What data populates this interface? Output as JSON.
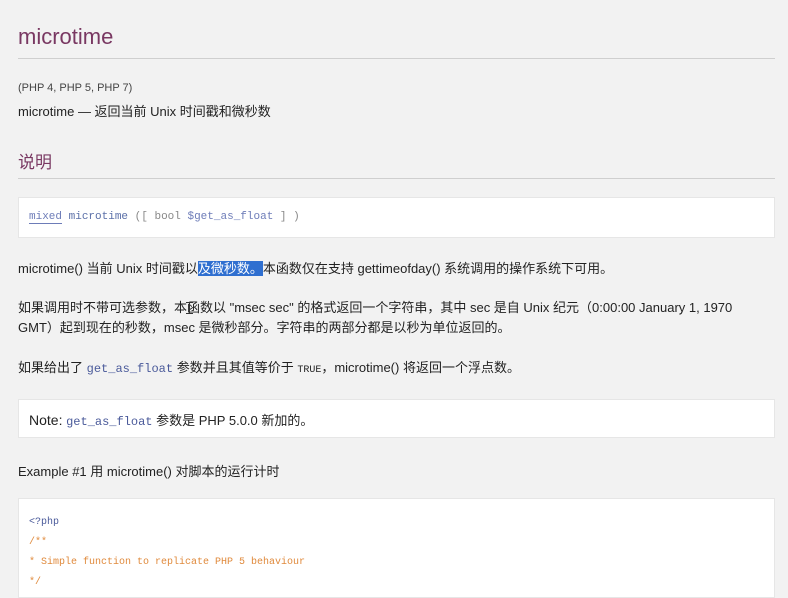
{
  "title": "microtime",
  "versions": "(PHP 4, PHP 5, PHP 7)",
  "refname": "microtime — 返回当前 Unix 时间戳和微秒数",
  "section_heading": "说明",
  "synopsis": {
    "type": "mixed",
    "function": "microtime",
    "open": "([",
    "param_type": "bool",
    "param": "$get_as_float",
    "close": "] )"
  },
  "para1": {
    "before": "microtime() 当前 Unix 时间戳以",
    "highlight": "及微秒数。",
    "after": "本函数仅在支持 gettimeofday() 系统调用的操作系统下可用。"
  },
  "para2": {
    "line1": "如果调用时不带可选参数，本函数以 \"msec sec\" 的格式返回一个字符串，其中 sec 是自 Unix 纪元（0:00:00 January 1, 1970",
    "line2": "GMT）起到现在的秒数，msec 是微秒部分。字符串的两部分都是以秒为单位返回的。"
  },
  "para3": {
    "before": "如果给出了",
    "param": "get_as_float",
    "middle": "参数并且其值等价于",
    "constant": "TRUE",
    "after": "，microtime() 将返回一个浮点数。"
  },
  "note": {
    "label": "Note:",
    "param": "get_as_float",
    "text": "参数是 PHP 5.0.0 新加的。"
  },
  "example_title": "Example #1 用 microtime() 对脚本的运行计时",
  "code_lines": [
    "<?php",
    "/**",
    " * Simple function to replicate PHP 5 behaviour",
    " */"
  ]
}
